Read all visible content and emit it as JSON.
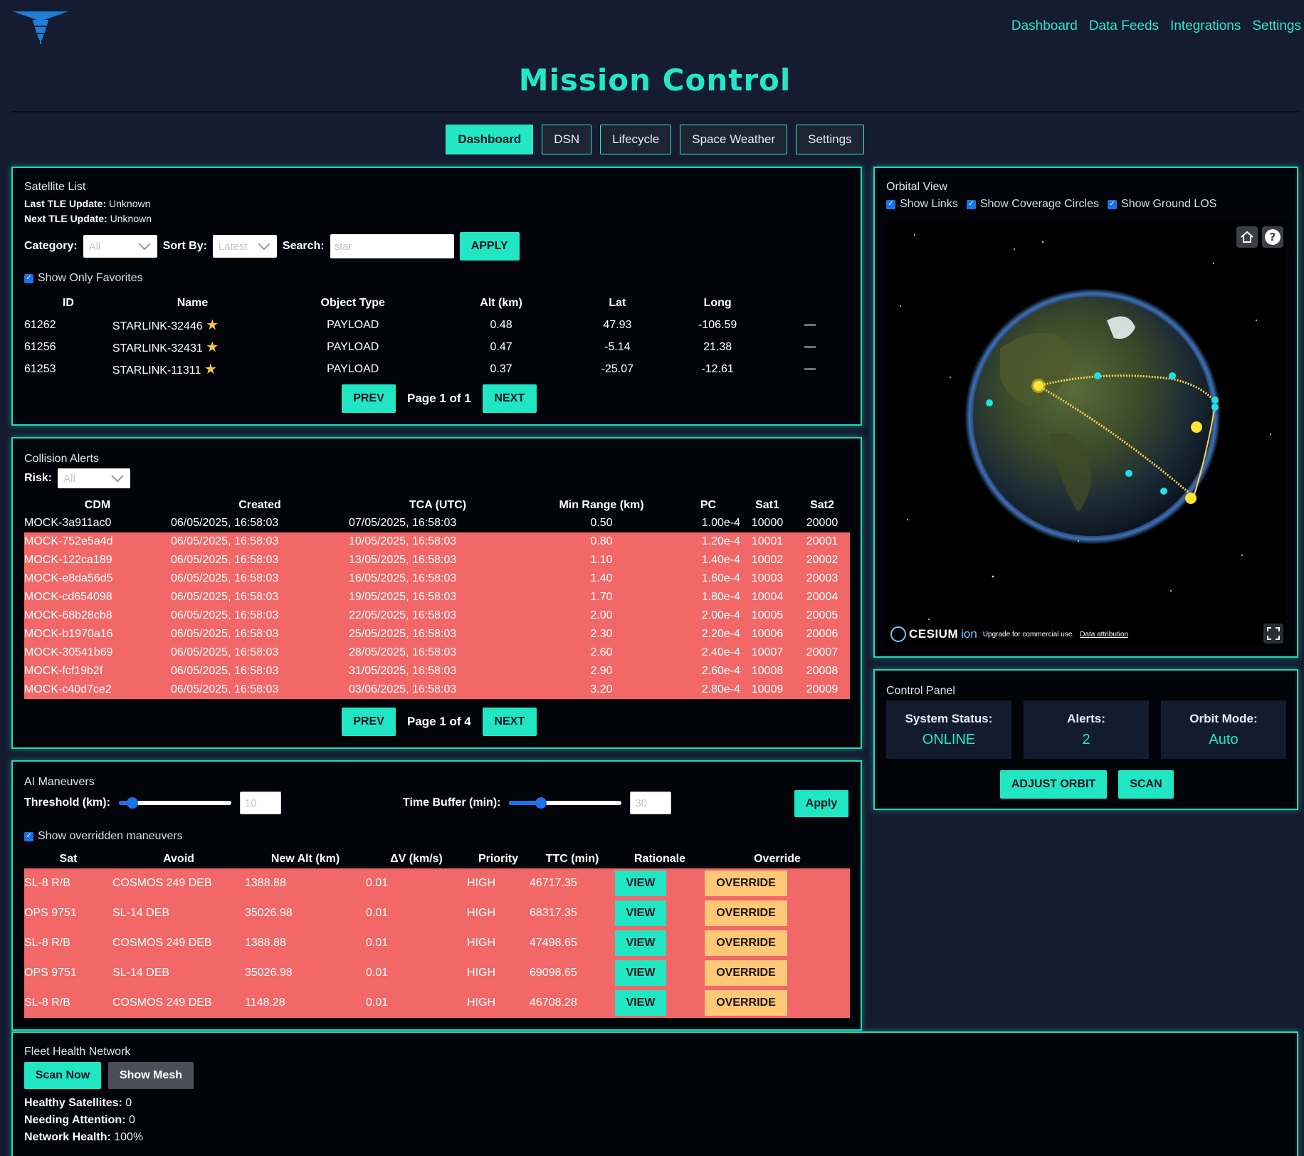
{
  "header": {
    "nav": [
      "Dashboard",
      "Data Feeds",
      "Integrations",
      "Settings"
    ],
    "title": "Mission Control",
    "tabs": [
      "Dashboard",
      "DSN",
      "Lifecycle",
      "Space Weather",
      "Settings"
    ],
    "active_tab": "Dashboard"
  },
  "satellite_list": {
    "title": "Satellite List",
    "last_tle_label": "Last TLE Update:",
    "last_tle_value": "Unknown",
    "next_tle_label": "Next TLE Update:",
    "next_tle_value": "Unknown",
    "category_label": "Category:",
    "category_value": "All",
    "sort_label": "Sort By:",
    "sort_value": "Latest",
    "search_label": "Search:",
    "search_value": "star",
    "apply_label": "APPLY",
    "favorites_label": "Show Only Favorites",
    "columns": [
      "ID",
      "Name",
      "Object Type",
      "Alt (km)",
      "Lat",
      "Long"
    ],
    "rows": [
      {
        "id": "61262",
        "name": "STARLINK-32446",
        "type": "PAYLOAD",
        "alt": "0.48",
        "lat": "47.93",
        "long": "-106.59"
      },
      {
        "id": "61256",
        "name": "STARLINK-32431",
        "type": "PAYLOAD",
        "alt": "0.47",
        "lat": "-5.14",
        "long": "21.38"
      },
      {
        "id": "61253",
        "name": "STARLINK-11311",
        "type": "PAYLOAD",
        "alt": "0.37",
        "lat": "-25.07",
        "long": "-12.61"
      }
    ],
    "prev_label": "PREV",
    "page_text": "Page 1 of 1",
    "next_label": "NEXT"
  },
  "collision_alerts": {
    "title": "Collision Alerts",
    "risk_label": "Risk:",
    "risk_value": "All",
    "columns": [
      "CDM",
      "Created",
      "TCA (UTC)",
      "Min Range (km)",
      "PC",
      "Sat1",
      "Sat2"
    ],
    "rows": [
      {
        "cdm": "MOCK-3a911ac0",
        "created": "06/05/2025, 16:58:03",
        "tca": "07/05/2025, 16:58:03",
        "range": "0.50",
        "pc": "1.00e-4",
        "sat1": "10000",
        "sat2": "20000",
        "alert": false
      },
      {
        "cdm": "MOCK-752e5a4d",
        "created": "06/05/2025, 16:58:03",
        "tca": "10/05/2025, 16:58:03",
        "range": "0.80",
        "pc": "1.20e-4",
        "sat1": "10001",
        "sat2": "20001",
        "alert": true
      },
      {
        "cdm": "MOCK-122ca189",
        "created": "06/05/2025, 16:58:03",
        "tca": "13/05/2025, 16:58:03",
        "range": "1.10",
        "pc": "1.40e-4",
        "sat1": "10002",
        "sat2": "20002",
        "alert": true
      },
      {
        "cdm": "MOCK-e8da56d5",
        "created": "06/05/2025, 16:58:03",
        "tca": "16/05/2025, 16:58:03",
        "range": "1.40",
        "pc": "1.60e-4",
        "sat1": "10003",
        "sat2": "20003",
        "alert": true
      },
      {
        "cdm": "MOCK-cd654098",
        "created": "06/05/2025, 16:58:03",
        "tca": "19/05/2025, 16:58:03",
        "range": "1.70",
        "pc": "1.80e-4",
        "sat1": "10004",
        "sat2": "20004",
        "alert": true
      },
      {
        "cdm": "MOCK-68b28cb8",
        "created": "06/05/2025, 16:58:03",
        "tca": "22/05/2025, 16:58:03",
        "range": "2.00",
        "pc": "2.00e-4",
        "sat1": "10005",
        "sat2": "20005",
        "alert": true
      },
      {
        "cdm": "MOCK-b1970a16",
        "created": "06/05/2025, 16:58:03",
        "tca": "25/05/2025, 16:58:03",
        "range": "2.30",
        "pc": "2.20e-4",
        "sat1": "10006",
        "sat2": "20006",
        "alert": true
      },
      {
        "cdm": "MOCK-30541b69",
        "created": "06/05/2025, 16:58:03",
        "tca": "28/05/2025, 16:58:03",
        "range": "2.60",
        "pc": "2.40e-4",
        "sat1": "10007",
        "sat2": "20007",
        "alert": true
      },
      {
        "cdm": "MOCK-fcf19b2f",
        "created": "06/05/2025, 16:58:03",
        "tca": "31/05/2025, 16:58:03",
        "range": "2.90",
        "pc": "2.60e-4",
        "sat1": "10008",
        "sat2": "20008",
        "alert": true
      },
      {
        "cdm": "MOCK-c40d7ce2",
        "created": "06/05/2025, 16:58:03",
        "tca": "03/06/2025, 16:58:03",
        "range": "3.20",
        "pc": "2.80e-4",
        "sat1": "10009",
        "sat2": "20009",
        "alert": true
      }
    ],
    "prev_label": "PREV",
    "page_text": "Page 1 of 4",
    "next_label": "NEXT"
  },
  "ai_maneuvers": {
    "title": "AI Maneuvers",
    "threshold_label": "Threshold (km):",
    "threshold_value": "10",
    "threshold_level": 0.12,
    "buffer_label": "Time Buffer (min):",
    "buffer_value": "30",
    "buffer_level": 0.28,
    "apply_label": "Apply",
    "overridden_label": "Show overridden maneuvers",
    "columns": [
      "Sat",
      "Avoid",
      "New Alt (km)",
      "ΔV (km/s)",
      "Priority",
      "TTC (min)",
      "Rationale",
      "Override"
    ],
    "rows": [
      {
        "sat": "SL-8 R/B",
        "avoid": "COSMOS 249 DEB",
        "alt": "1388.88",
        "dv": "0.01",
        "priority": "HIGH",
        "ttc": "46717.35"
      },
      {
        "sat": "OPS 9751",
        "avoid": "SL-14 DEB",
        "alt": "35026.98",
        "dv": "0.01",
        "priority": "HIGH",
        "ttc": "68317.35"
      },
      {
        "sat": "SL-8 R/B",
        "avoid": "COSMOS 249 DEB",
        "alt": "1388.88",
        "dv": "0.01",
        "priority": "HIGH",
        "ttc": "47498.65"
      },
      {
        "sat": "OPS 9751",
        "avoid": "SL-14 DEB",
        "alt": "35026.98",
        "dv": "0.01",
        "priority": "HIGH",
        "ttc": "69098.65"
      },
      {
        "sat": "SL-8 R/B",
        "avoid": "COSMOS 249 DEB",
        "alt": "1148.28",
        "dv": "0.01",
        "priority": "HIGH",
        "ttc": "46708.28"
      }
    ],
    "view_label": "VIEW",
    "override_label": "OVERRIDE"
  },
  "orbital_view": {
    "title": "Orbital View",
    "show_links": "Show Links",
    "show_coverage": "Show Coverage Circles",
    "show_los": "Show Ground LOS",
    "cesium_brand": "CESIUM",
    "cesium_ion": "ion",
    "upgrade_text": "Upgrade for commercial use.",
    "attribution_text": "Data attribution"
  },
  "control_panel": {
    "title": "Control Panel",
    "status_label": "System Status:",
    "status_value": "ONLINE",
    "alerts_label": "Alerts:",
    "alerts_value": "2",
    "orbit_label": "Orbit Mode:",
    "orbit_value": "Auto",
    "adjust_label": "ADJUST ORBIT",
    "scan_label": "SCAN"
  },
  "fleet_health": {
    "title": "Fleet Health Network",
    "scan_now": "Scan Now",
    "show_mesh": "Show Mesh",
    "healthy_label": "Healthy Satellites:",
    "healthy_value": "0",
    "attention_label": "Needing Attention:",
    "attention_value": "0",
    "network_label": "Network Health:",
    "network_value": "100%"
  },
  "colors": {
    "accent": "#22e8c6",
    "alert_row": "#f26868",
    "override": "#ffc877",
    "background": "#151c31"
  }
}
